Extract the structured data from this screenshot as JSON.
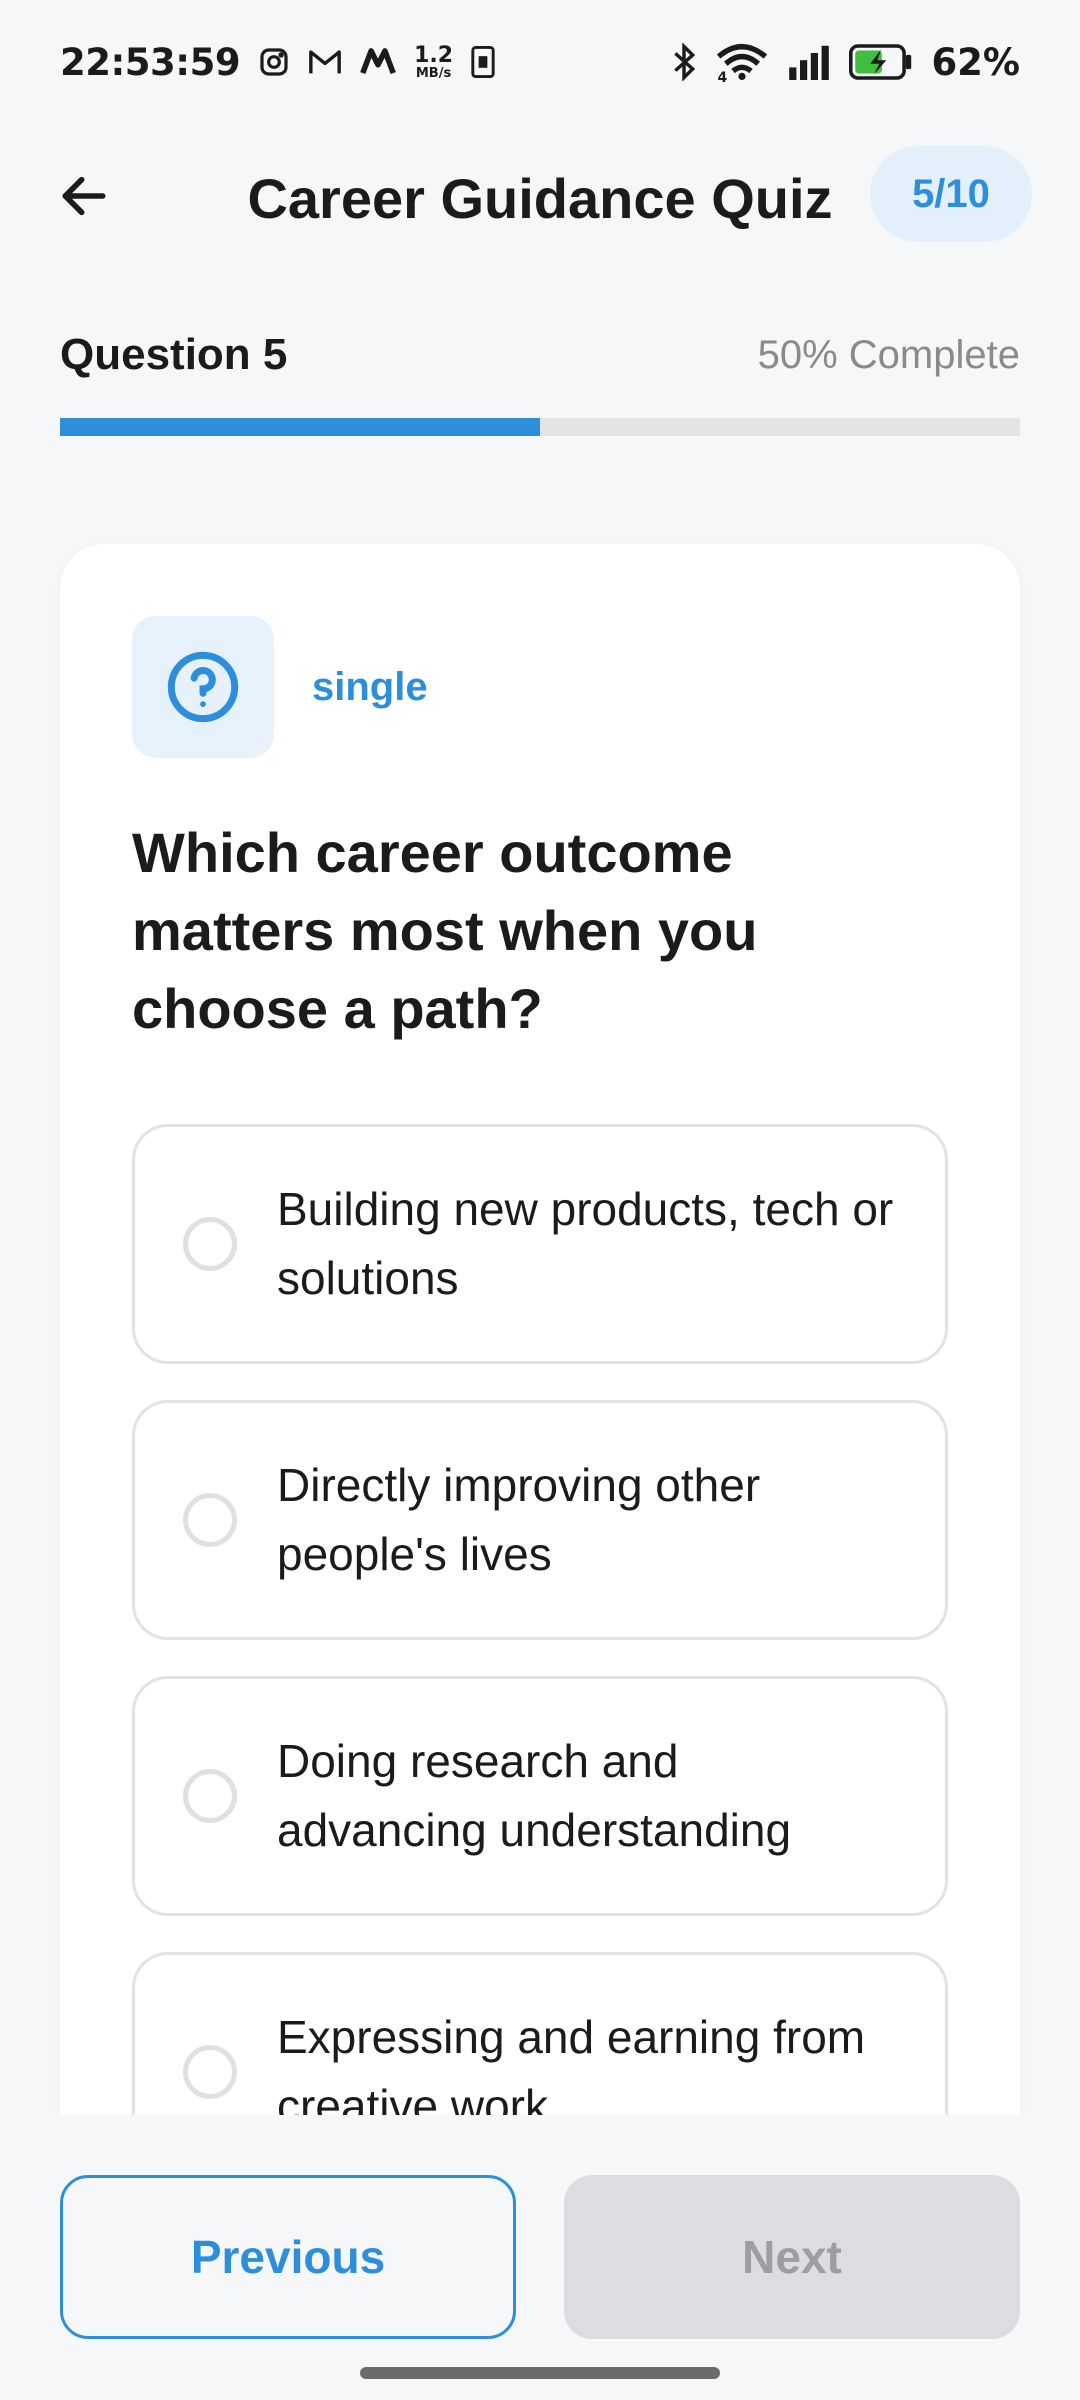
{
  "status_bar": {
    "time": "22:53:59",
    "net_speed_value": "1.2",
    "net_speed_unit": "MB/s",
    "wifi_label": "4",
    "battery_percent": "62%"
  },
  "header": {
    "title": "Career Guidance Quiz",
    "progress_chip": "5/10"
  },
  "progress": {
    "question_label": "Question 5",
    "complete_label": "50% Complete",
    "fraction": 0.5
  },
  "question": {
    "type": "single",
    "text": "Which career outcome matters most when you choose a path?",
    "options": [
      {
        "label": "Building new products, tech or solutions"
      },
      {
        "label": "Directly improving other people's lives"
      },
      {
        "label": "Doing research and advancing understanding"
      },
      {
        "label": "Expressing and earning from creative work"
      }
    ]
  },
  "footer": {
    "previous_label": "Previous",
    "next_label": "Next"
  },
  "colors": {
    "accent": "#2d8fdc",
    "disabled_bg": "#dcdde0",
    "disabled_text": "#9c9ea2"
  },
  "icons": {
    "back": "arrow-left-icon",
    "question_type": "question-circle-icon"
  }
}
